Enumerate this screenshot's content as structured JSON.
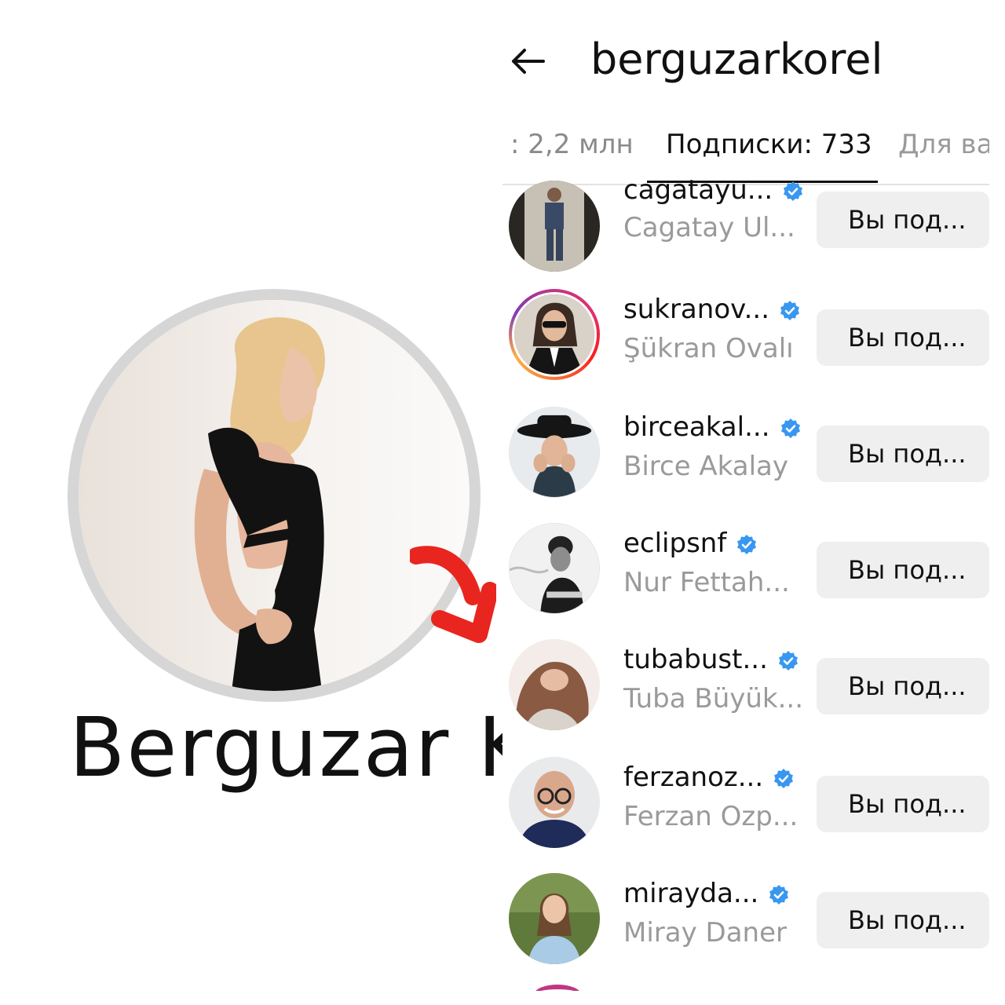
{
  "collage": {
    "big_name": "Berguzar Kı"
  },
  "header": {
    "username": "berguzarkorel"
  },
  "tabs": {
    "followers": ": 2,2 млн",
    "following": "Подписки: 733",
    "for_you": "Для ва"
  },
  "following_list": [
    {
      "handle": "cagatayu...",
      "name": "Cagatay Ul...",
      "button": "Вы под..."
    },
    {
      "handle": "sukranov...",
      "name": "Şükran Ovalı",
      "button": "Вы под..."
    },
    {
      "handle": "birceakal...",
      "name": "Birce Akalay",
      "button": "Вы под..."
    },
    {
      "handle": "eclipsnf",
      "name": "Nur Fettah...",
      "button": "Вы под..."
    },
    {
      "handle": "tubabust...",
      "name": "Tuba Büyük...",
      "button": "Вы под..."
    },
    {
      "handle": "ferzanoz...",
      "name": "Ferzan Ozp...",
      "button": "Вы под..."
    },
    {
      "handle": "mirayda...",
      "name": "Miray Daner",
      "button": "Вы под..."
    }
  ],
  "colors": {
    "verified_blue": "#3897f0",
    "arrow_red": "#e8261f",
    "button_gray": "#efefef",
    "muted_text": "#9a9a9a"
  },
  "icons": [
    "back-arrow-icon",
    "verified-badge-icon",
    "red-curved-arrow-icon"
  ]
}
